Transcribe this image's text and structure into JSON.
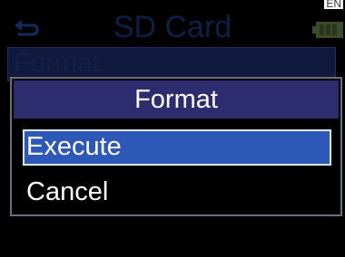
{
  "screen": {
    "corner_label": "EN",
    "title": "SD Card",
    "background_item": "Format"
  },
  "dialog": {
    "title": "Format",
    "options": [
      {
        "label": "Execute",
        "selected": true
      },
      {
        "label": "Cancel",
        "selected": false
      }
    ]
  },
  "colors": {
    "screen_bg": "#000000",
    "dialog_title_bg": "#2c2c6e",
    "selected_bg": "#2e58b8",
    "text": "#ffffff"
  }
}
